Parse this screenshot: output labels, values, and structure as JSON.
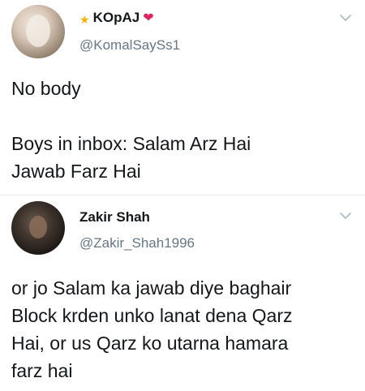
{
  "tweets": [
    {
      "display_name": "KOpAJ",
      "handle": "@KomalSaySs1",
      "text": "No body\n\nBoys in inbox: Salam Arz Hai\nJawab Farz Hai",
      "icons": {
        "before_name": "star-icon",
        "after_name": "heart-icon",
        "menu": "chevron-down-icon"
      }
    },
    {
      "display_name": "Zakir Shah",
      "handle": "@Zakir_Shah1996",
      "text": "or jo Salam ka jawab diye baghair\nBlock krden unko lanat dena Qarz\nHai,  or us Qarz ko utarna hamara\nfarz hai",
      "icons": {
        "menu": "chevron-down-icon"
      }
    }
  ],
  "colors": {
    "text": "#14171a",
    "secondary": "#657786",
    "heart": "#e0245e",
    "star": "#f5b400",
    "divider": "#e6ecf0"
  }
}
